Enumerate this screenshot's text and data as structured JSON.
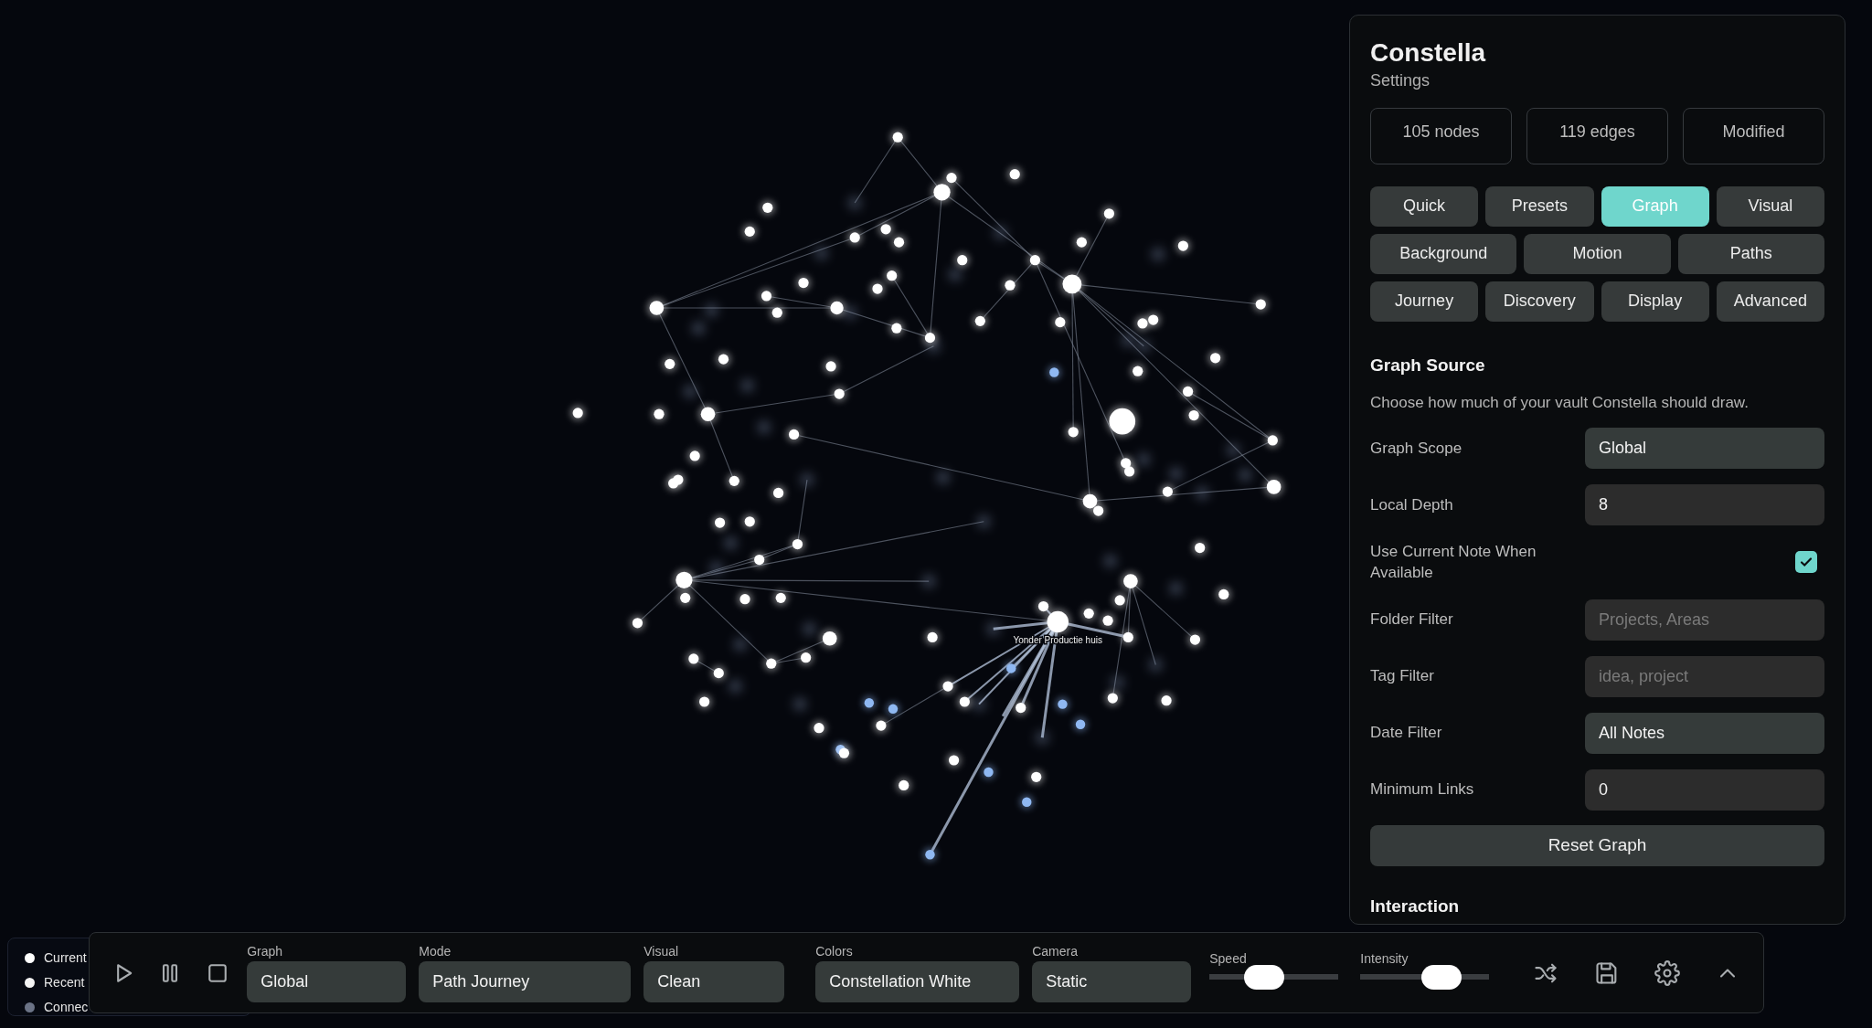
{
  "graph": {
    "focus_label": "Yonder Productie huis"
  },
  "legend": [
    {
      "label": "Current",
      "color": "#ffffff"
    },
    {
      "label": "Recent",
      "color": "#f4f4f4"
    },
    {
      "label": "Connec",
      "color": "#6b7386"
    }
  ],
  "toolbar": [
    {
      "kind": "select",
      "label": "Graph",
      "value": "Global"
    },
    {
      "kind": "select",
      "label": "Mode",
      "value": "Path Journey"
    },
    {
      "kind": "select",
      "label": "Visual",
      "value": "Clean"
    },
    {
      "kind": "select",
      "label": "Colors",
      "value": "Constellation White"
    },
    {
      "kind": "select",
      "label": "Camera",
      "value": "Static"
    },
    {
      "kind": "slider",
      "label": "Speed",
      "level": 0.39
    },
    {
      "kind": "slider",
      "label": "Intensity",
      "level": 0.69
    }
  ],
  "panel": {
    "title": "Constella",
    "subtitle": "Settings",
    "stats": [
      "105 nodes",
      "119 edges",
      "Modified"
    ],
    "tab_rows": [
      [
        {
          "label": "Quick",
          "selected": false
        },
        {
          "label": "Presets",
          "selected": false
        },
        {
          "label": "Graph",
          "selected": true
        },
        {
          "label": "Visual",
          "selected": false
        }
      ],
      [
        {
          "label": "Background",
          "selected": false
        },
        {
          "label": "Motion",
          "selected": false
        },
        {
          "label": "Paths",
          "selected": false
        }
      ],
      [
        {
          "label": "Journey",
          "selected": false
        },
        {
          "label": "Discovery",
          "selected": false
        },
        {
          "label": "Display",
          "selected": false
        },
        {
          "label": "Advanced",
          "selected": false
        }
      ]
    ],
    "section_title": "Graph Source",
    "section_description": "Choose how much of your vault Constella should draw.",
    "fields": [
      {
        "kind": "select",
        "label": "Graph Scope",
        "value": "Global"
      },
      {
        "kind": "number",
        "label": "Local Depth",
        "value": "8"
      },
      {
        "kind": "checkbox",
        "label": "Use Current Note When Available",
        "checked": true
      },
      {
        "kind": "text",
        "label": "Folder Filter",
        "placeholder": "Projects, Areas"
      },
      {
        "kind": "text",
        "label": "Tag Filter",
        "placeholder": "idea, project"
      },
      {
        "kind": "select",
        "label": "Date Filter",
        "value": "All Notes"
      },
      {
        "kind": "number",
        "label": "Minimum Links",
        "value": "0"
      }
    ],
    "reset_button": "Reset Graph",
    "next_section_title": "Interaction"
  }
}
